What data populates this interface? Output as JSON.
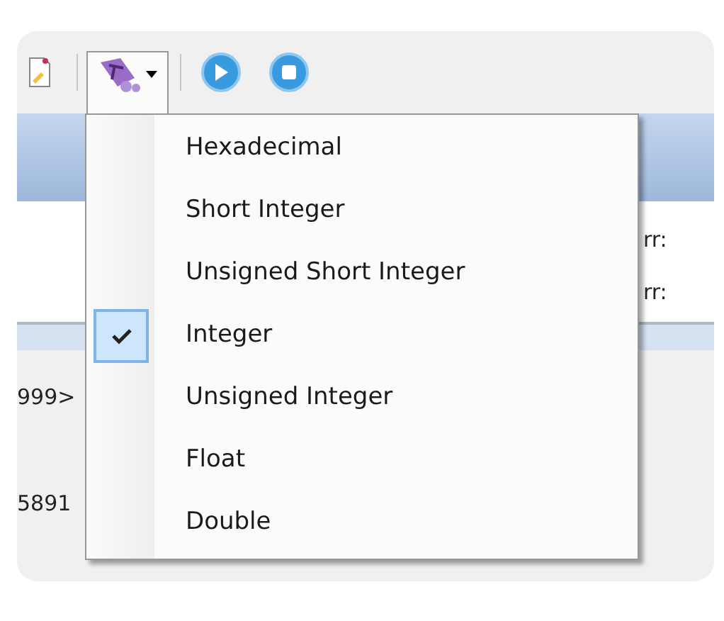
{
  "toolbar": {
    "dropdown": {
      "expanded": true
    }
  },
  "panel": {
    "labels": [
      "rr:",
      "rr:"
    ]
  },
  "output": {
    "lines": [
      "999>",
      "5891"
    ]
  },
  "menu": {
    "items": [
      {
        "label": "Hexadecimal",
        "checked": false
      },
      {
        "label": "Short Integer",
        "checked": false
      },
      {
        "label": "Unsigned Short Integer",
        "checked": false
      },
      {
        "label": "Integer",
        "checked": true
      },
      {
        "label": "Unsigned Integer",
        "checked": false
      },
      {
        "label": "Float",
        "checked": false
      },
      {
        "label": "Double",
        "checked": false
      }
    ]
  }
}
